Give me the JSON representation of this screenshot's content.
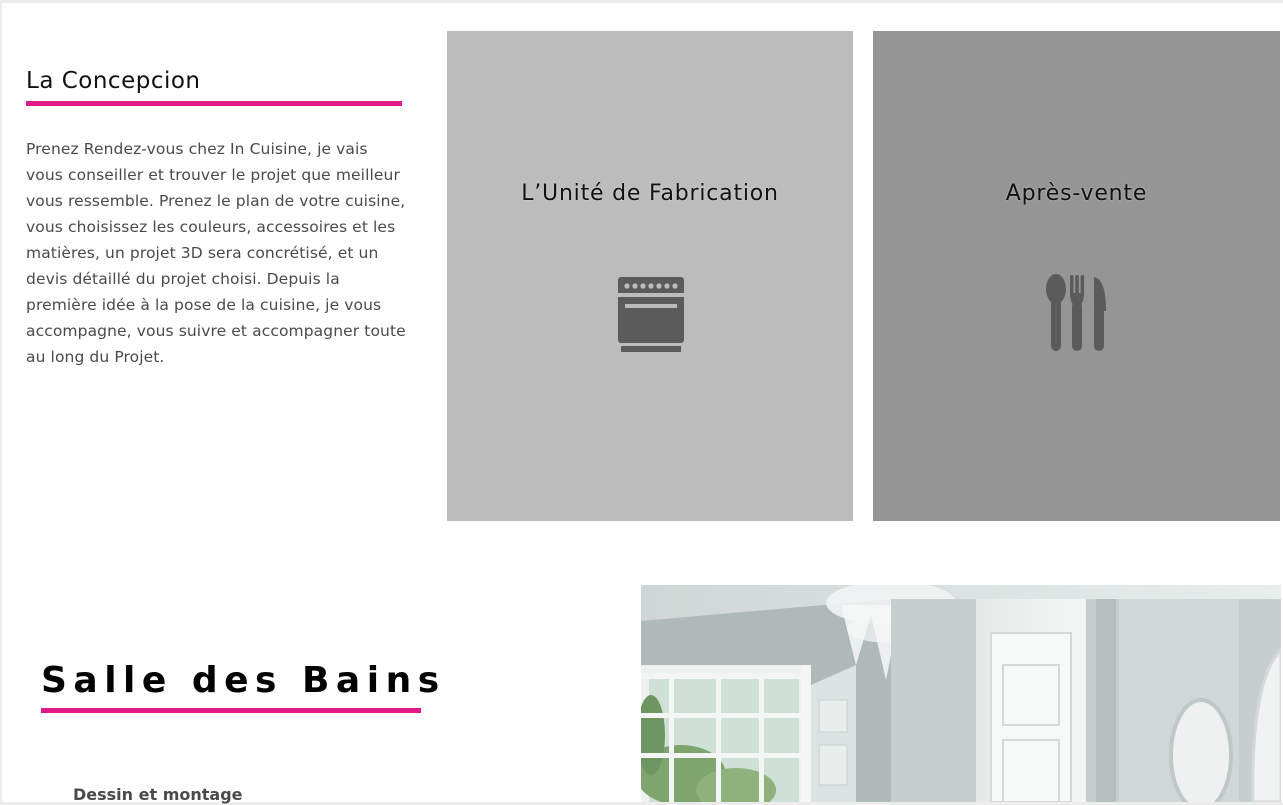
{
  "concept": {
    "title": "La Concepcion",
    "text": "Prenez Rendez-vous chez In Cuisine, je vais vous conseiller et trouver le projet que meilleur vous ressemble. Prenez le plan de votre cuisine, vous choisissez les couleurs, accessoires et les matières, un projet 3D sera concrétisé, et un devis détaillé du projet choisi. Depuis la première idée à la pose de la cuisine, je vous accompagne, vous suivre et accompagner toute au long du Projet."
  },
  "cards": [
    {
      "title": "L’Unité de Fabrication",
      "icon": "oven-icon",
      "color": "#bcbcbc"
    },
    {
      "title": "Après-vente",
      "icon": "cutlery-icon",
      "color": "#959595"
    }
  ],
  "bathroom": {
    "title": "Salle des Bains",
    "subtitle": "Dessin et montage"
  },
  "colors": {
    "accent": "#e01a86",
    "icon": "#5b5b5b"
  }
}
